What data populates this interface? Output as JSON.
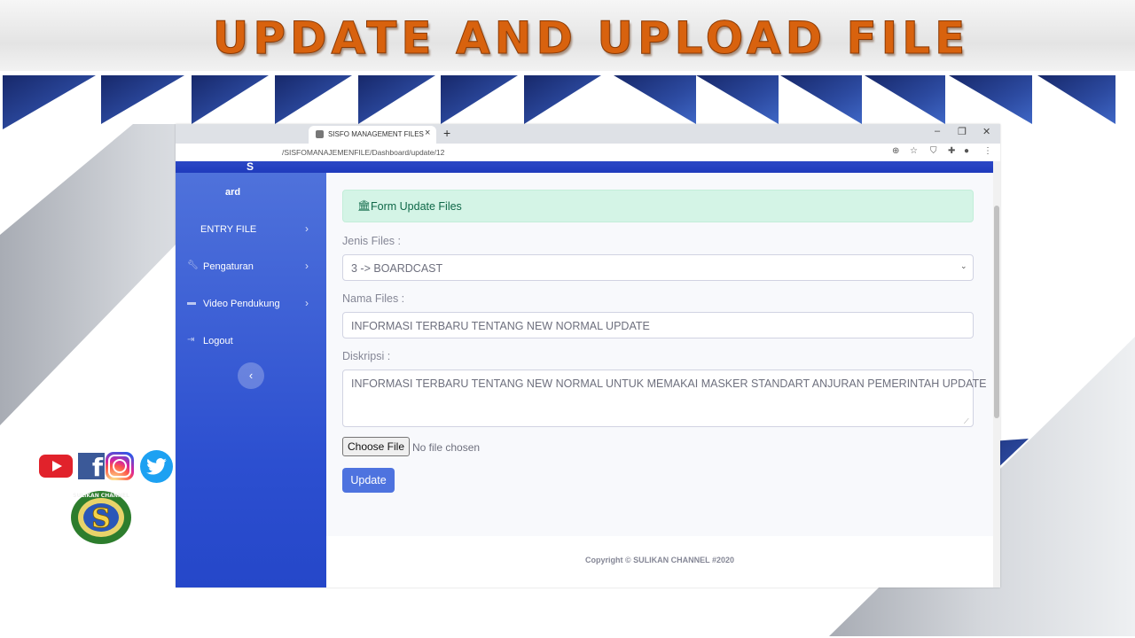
{
  "video": {
    "title": "UPDATE AND UPLOAD FILE",
    "social_icons": [
      "youtube-icon",
      "facebook-icon",
      "instagram-icon",
      "twitter-icon"
    ],
    "logo_letter": "S",
    "logo_text": "SULIKAN CHANNEL"
  },
  "browser": {
    "tab_title": "SISFO MANAGEMENT FILES",
    "tab_close": "×",
    "new_tab": "+",
    "url": "/SISFOMANAJEMENFILE/Dashboard/update/12",
    "window_controls": {
      "minimize": "–",
      "restore": "❐",
      "close": "✕"
    }
  },
  "sidebar": {
    "brand_fragment": "S",
    "items": [
      {
        "icon": "dashboard-icon",
        "label": "Dashboard",
        "visible_label": "ard",
        "has_arrow": false
      },
      {
        "icon": "folder-icon",
        "label": "ENTRY FILE",
        "visible_label": "ENTRY FILE",
        "has_arrow": true
      },
      {
        "icon": "wrench-icon",
        "label": "Pengaturan",
        "visible_label": "Pengaturan",
        "has_arrow": true
      },
      {
        "icon": "folder-icon",
        "label": "Video Pendukung",
        "visible_label": "Video Pendukung",
        "has_arrow": true
      },
      {
        "icon": "logout-icon",
        "label": "Logout",
        "visible_label": "Logout",
        "has_arrow": false
      }
    ],
    "arrow": "›",
    "toggle": "‹"
  },
  "form": {
    "header": "Form Update Files",
    "jenis_label": "Jenis Files :",
    "jenis_value": "3 -> BOARDCAST",
    "nama_label": "Nama Files :",
    "nama_value": "INFORMASI TERBARU TENTANG NEW NORMAL UPDATE",
    "deskripsi_label": "Diskripsi :",
    "deskripsi_value": "INFORMASI TERBARU TENTANG NEW NORMAL UNTUK MEMAKAI MASKER STANDART ANJURAN PEMERINTAH UPDATE",
    "file_button": "Choose File",
    "file_status": "No file chosen",
    "submit": "Update"
  },
  "footer": {
    "copyright": "Copyright © SULIKAN CHANNEL #2020"
  },
  "colors": {
    "title_orange": "#d8620e",
    "primary": "#4e73df",
    "sidebar": "#3a5cd6",
    "alert_bg": "#d4f4e6",
    "alert_text": "#0f6848",
    "banner_navy": "#1e3474"
  }
}
